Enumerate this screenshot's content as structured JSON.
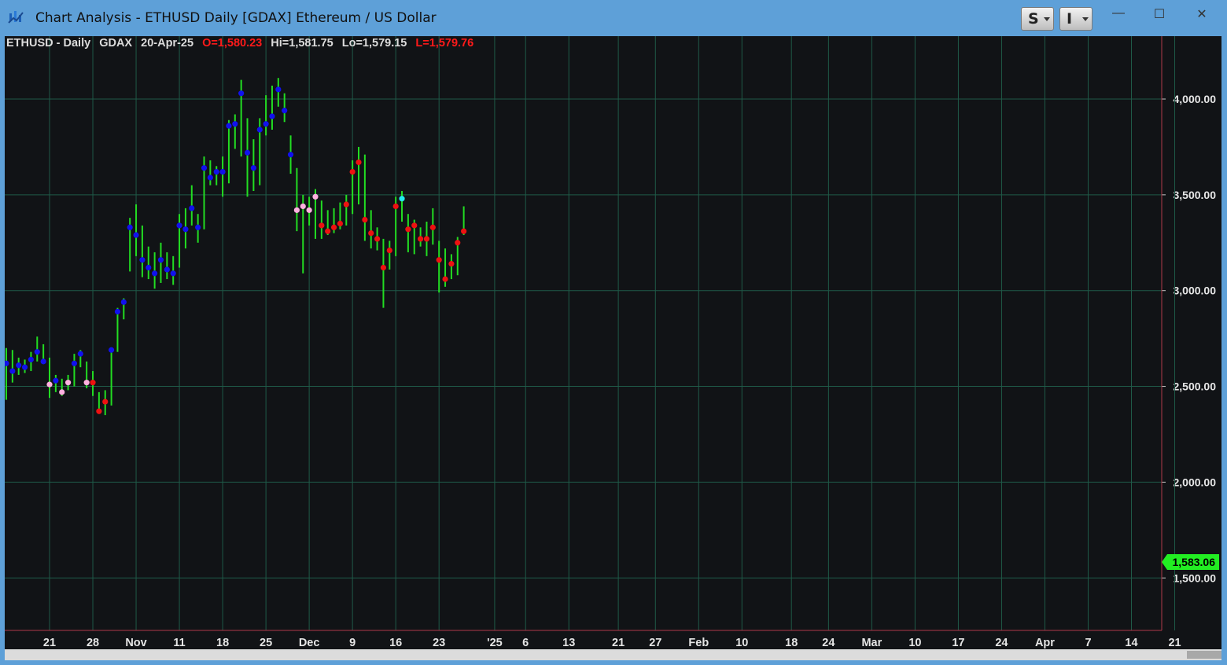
{
  "window": {
    "title": "Chart Analysis - ETHUSD Daily [GDAX] Ethereum / US Dollar",
    "buttons": [
      {
        "label": "S"
      },
      {
        "label": "I"
      }
    ],
    "controls": {
      "minimize": "—",
      "maximize": "☐",
      "close": "✕"
    }
  },
  "info_bar": {
    "symbol": "ETHUSD - Daily",
    "exchange": "GDAX",
    "date": "20-Apr-25",
    "open": "O=1,580.23",
    "high": "Hi=1,581.75",
    "low": "Lo=1,579.15",
    "last": "L=1,579.76"
  },
  "colors": {
    "background": "#111316",
    "grid": "#1f5a48",
    "bar": "#22dd22",
    "dot_blue": "#1111ee",
    "dot_red": "#ee1111",
    "dot_pink": "#ffb0e0",
    "dot_cyan": "#22e8ee",
    "last_price_badge": "#22ee22"
  },
  "chart_data": {
    "type": "ohlc",
    "title": "ETHUSD Daily [GDAX] Ethereum / US Dollar",
    "ylim": [
      1270,
      4300
    ],
    "y_ticks": [
      "4,000.00",
      "3,500.00",
      "3,000.00",
      "2,500.00",
      "2,000.00",
      "1,500.00"
    ],
    "y_tick_values": [
      4000,
      3500,
      3000,
      2500,
      2000,
      1500
    ],
    "x_ticks": [
      "21",
      "28",
      "Nov",
      "11",
      "18",
      "25",
      "Dec",
      "9",
      "16",
      "23",
      "'25",
      "6",
      "13",
      "21",
      "27",
      "Feb",
      "10",
      "18",
      "24",
      "Mar",
      "10",
      "17",
      "24",
      "Apr",
      "7",
      "14",
      "21"
    ],
    "x_tick_dates": [
      "2024-10-21",
      "2024-10-28",
      "2024-11-04",
      "2024-11-11",
      "2024-11-18",
      "2024-11-25",
      "2024-12-02",
      "2024-12-09",
      "2024-12-16",
      "2024-12-23",
      "2025-01-01",
      "2025-01-06",
      "2025-01-13",
      "2025-01-21",
      "2025-01-27",
      "2025-02-03",
      "2025-02-10",
      "2025-02-18",
      "2025-02-24",
      "2025-03-03",
      "2025-03-10",
      "2025-03-17",
      "2025-03-24",
      "2025-03-31",
      "2025-04-07",
      "2025-04-14",
      "2025-04-21"
    ],
    "last_price": "1,583.06",
    "last_price_value": 1583.06,
    "grid": true,
    "dot_legend": {
      "b": "blue",
      "r": "red",
      "p": "pink",
      "c": "cyan"
    },
    "bars": [
      [
        "2024-10-14",
        2700,
        2430,
        2620,
        "b"
      ],
      [
        "2024-10-15",
        2690,
        2520,
        2580,
        "b"
      ],
      [
        "2024-10-16",
        2650,
        2560,
        2610,
        "b"
      ],
      [
        "2024-10-17",
        2640,
        2570,
        2600,
        "b"
      ],
      [
        "2024-10-18",
        2680,
        2580,
        2640,
        "b"
      ],
      [
        "2024-10-19",
        2760,
        2630,
        2680,
        "b"
      ],
      [
        "2024-10-20",
        2720,
        2620,
        2630,
        "b"
      ],
      [
        "2024-10-21",
        2650,
        2440,
        2510,
        "p"
      ],
      [
        "2024-10-22",
        2560,
        2470,
        2530,
        "b"
      ],
      [
        "2024-10-23",
        2540,
        2450,
        2470,
        "p"
      ],
      [
        "2024-10-24",
        2560,
        2480,
        2520,
        "p"
      ],
      [
        "2024-10-25",
        2670,
        2500,
        2620,
        "b"
      ],
      [
        "2024-10-26",
        2690,
        2600,
        2670,
        "b"
      ],
      [
        "2024-10-27",
        2630,
        2490,
        2520,
        "p"
      ],
      [
        "2024-10-28",
        2580,
        2450,
        2520,
        "r"
      ],
      [
        "2024-10-29",
        2470,
        2360,
        2370,
        "r"
      ],
      [
        "2024-10-30",
        2480,
        2350,
        2420,
        "r"
      ],
      [
        "2024-10-31",
        2700,
        2400,
        2690,
        "b"
      ],
      [
        "2024-11-01",
        2910,
        2680,
        2890,
        "b"
      ],
      [
        "2024-11-02",
        2960,
        2850,
        2940,
        "b"
      ],
      [
        "2024-11-03",
        3380,
        3100,
        3330,
        "b"
      ],
      [
        "2024-11-04",
        3450,
        3180,
        3290,
        "b"
      ],
      [
        "2024-11-05",
        3340,
        3070,
        3160,
        "b"
      ],
      [
        "2024-11-06",
        3230,
        3060,
        3120,
        "b"
      ],
      [
        "2024-11-07",
        3200,
        3010,
        3090,
        "b"
      ],
      [
        "2024-11-08",
        3250,
        3040,
        3160,
        "b"
      ],
      [
        "2024-11-09",
        3200,
        3060,
        3110,
        "b"
      ],
      [
        "2024-11-10",
        3180,
        3030,
        3090,
        "b"
      ],
      [
        "2024-11-11",
        3400,
        3120,
        3340,
        "b"
      ],
      [
        "2024-11-12",
        3430,
        3220,
        3320,
        "b"
      ],
      [
        "2024-11-13",
        3550,
        3340,
        3430,
        "b"
      ],
      [
        "2024-11-14",
        3400,
        3250,
        3330,
        "b"
      ],
      [
        "2024-11-15",
        3700,
        3320,
        3640,
        "b"
      ],
      [
        "2024-11-16",
        3680,
        3550,
        3590,
        "b"
      ],
      [
        "2024-11-17",
        3650,
        3550,
        3620,
        "b"
      ],
      [
        "2024-11-18",
        3700,
        3490,
        3620,
        "b"
      ],
      [
        "2024-11-19",
        3890,
        3560,
        3860,
        "b"
      ],
      [
        "2024-11-20",
        3920,
        3740,
        3870,
        "b"
      ],
      [
        "2024-11-21",
        4100,
        3700,
        4030,
        "b"
      ],
      [
        "2024-11-22",
        3900,
        3490,
        3720,
        "b"
      ],
      [
        "2024-11-23",
        3790,
        3520,
        3640,
        "b"
      ],
      [
        "2024-11-24",
        3900,
        3550,
        3840,
        "b"
      ],
      [
        "2024-11-25",
        4020,
        3810,
        3870,
        "b"
      ],
      [
        "2024-11-26",
        4070,
        3840,
        3910,
        "b"
      ],
      [
        "2024-11-27",
        4110,
        3960,
        4050,
        "b"
      ],
      [
        "2024-11-28",
        4030,
        3880,
        3940,
        "b"
      ],
      [
        "2024-11-29",
        3810,
        3610,
        3710,
        "b"
      ],
      [
        "2024-11-30",
        3640,
        3310,
        3420,
        "p"
      ],
      [
        "2024-12-01",
        3500,
        3090,
        3440,
        "p"
      ],
      [
        "2024-12-02",
        3490,
        3340,
        3420,
        "p"
      ],
      [
        "2024-12-03",
        3530,
        3270,
        3490,
        "p"
      ],
      [
        "2024-12-04",
        3470,
        3270,
        3340,
        "r"
      ],
      [
        "2024-12-05",
        3420,
        3290,
        3310,
        "r"
      ],
      [
        "2024-12-06",
        3430,
        3300,
        3330,
        "r"
      ],
      [
        "2024-12-07",
        3460,
        3320,
        3350,
        "r"
      ],
      [
        "2024-12-08",
        3500,
        3340,
        3450,
        "r"
      ],
      [
        "2024-12-09",
        3680,
        3400,
        3620,
        "r"
      ],
      [
        "2024-12-10",
        3750,
        3450,
        3670,
        "r"
      ],
      [
        "2024-12-11",
        3710,
        3260,
        3370,
        "r"
      ],
      [
        "2024-12-12",
        3420,
        3220,
        3300,
        "r"
      ],
      [
        "2024-12-13",
        3330,
        3210,
        3270,
        "r"
      ],
      [
        "2024-12-14",
        3270,
        2910,
        3120,
        "r"
      ],
      [
        "2024-12-15",
        3260,
        3110,
        3210,
        "r"
      ],
      [
        "2024-12-16",
        3490,
        3180,
        3440,
        "r"
      ],
      [
        "2024-12-17",
        3520,
        3360,
        3480,
        "c"
      ],
      [
        "2024-12-18",
        3400,
        3200,
        3320,
        "r"
      ],
      [
        "2024-12-19",
        3370,
        3190,
        3340,
        "r"
      ],
      [
        "2024-12-20",
        3330,
        3230,
        3270,
        "r"
      ],
      [
        "2024-12-21",
        3360,
        3180,
        3270,
        "r"
      ],
      [
        "2024-12-22",
        3430,
        3240,
        3330,
        "r"
      ],
      [
        "2024-12-23",
        3260,
        2990,
        3160,
        "r"
      ],
      [
        "2024-12-24",
        3220,
        3020,
        3060,
        "r"
      ],
      [
        "2024-12-25",
        3190,
        3060,
        3140,
        "r"
      ],
      [
        "2024-12-26",
        3280,
        3080,
        3250,
        "r"
      ],
      [
        "2024-12-27",
        3440,
        3290,
        3310,
        "r"
      ]
    ]
  }
}
